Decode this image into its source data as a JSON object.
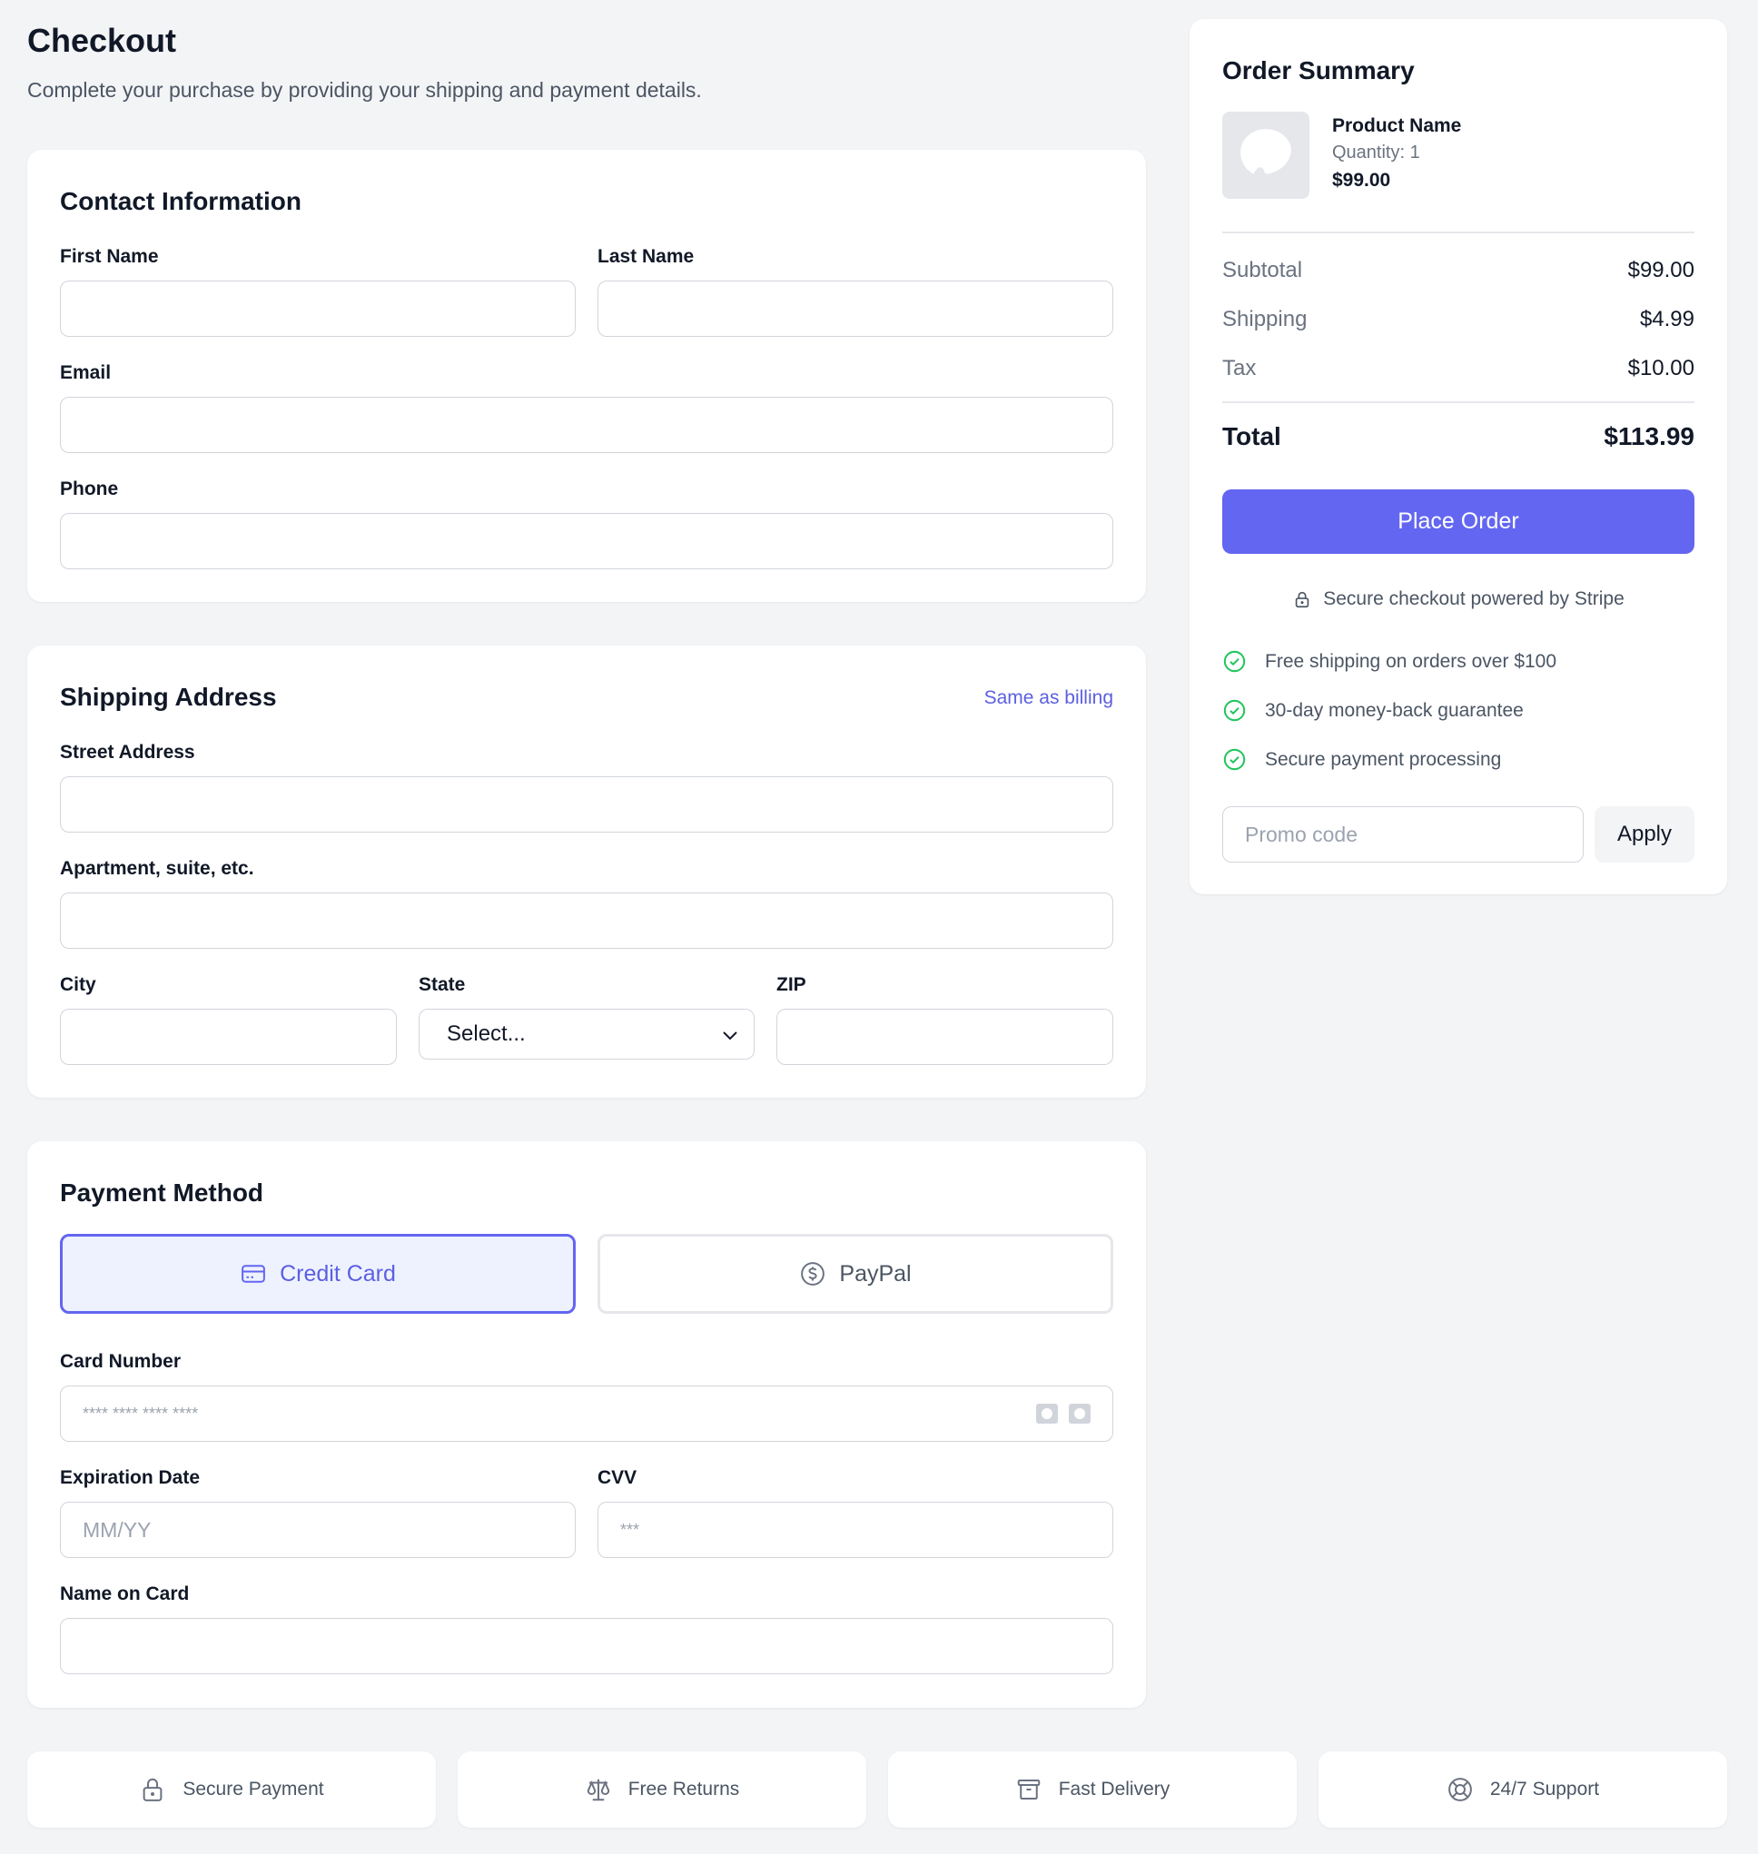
{
  "header": {
    "title": "Checkout",
    "subtitle": "Complete your purchase by providing your shipping and payment details."
  },
  "contact": {
    "title": "Contact Information",
    "first_name_label": "First Name",
    "last_name_label": "Last Name",
    "email_label": "Email",
    "phone_label": "Phone"
  },
  "shipping": {
    "title": "Shipping Address",
    "same_as_billing": "Same as billing",
    "street_label": "Street Address",
    "apartment_label": "Apartment, suite, etc.",
    "city_label": "City",
    "state_label": "State",
    "state_value": "Select...",
    "zip_label": "ZIP"
  },
  "payment": {
    "title": "Payment Method",
    "options": [
      {
        "label": "Credit Card",
        "icon": "credit-card-icon",
        "selected": true
      },
      {
        "label": "PayPal",
        "icon": "dollar-circle-icon",
        "selected": false
      }
    ],
    "card_number_label": "Card Number",
    "card_number_placeholder": "**** **** **** ****",
    "expiration_label": "Expiration Date",
    "expiration_placeholder": "MM/YY",
    "cvv_label": "CVV",
    "cvv_placeholder": "***",
    "name_on_card_label": "Name on Card"
  },
  "summary": {
    "title": "Order Summary",
    "product": {
      "name": "Product Name",
      "quantity": "Quantity: 1",
      "price": "$99.00"
    },
    "rows": [
      {
        "label": "Subtotal",
        "value": "$99.00"
      },
      {
        "label": "Shipping",
        "value": "$4.99"
      },
      {
        "label": "Tax",
        "value": "$10.00"
      }
    ],
    "total_label": "Total",
    "total_value": "$113.99",
    "place_order": "Place Order",
    "secure_note": "Secure checkout powered by Stripe",
    "features": [
      "Free shipping on orders over $100",
      "30-day money-back guarantee",
      "Secure payment processing"
    ],
    "promo_placeholder": "Promo code",
    "apply_label": "Apply"
  },
  "footer": {
    "items": [
      {
        "label": "Secure Payment",
        "icon": "lock-icon"
      },
      {
        "label": "Free Returns",
        "icon": "scale-icon"
      },
      {
        "label": "Fast Delivery",
        "icon": "archive-box-icon"
      },
      {
        "label": "24/7 Support",
        "icon": "lifebuoy-icon"
      }
    ]
  },
  "colors": {
    "accent": "#6366f1",
    "accent_light": "#eef2ff",
    "success": "#22c55e",
    "background": "#f3f4f6"
  }
}
